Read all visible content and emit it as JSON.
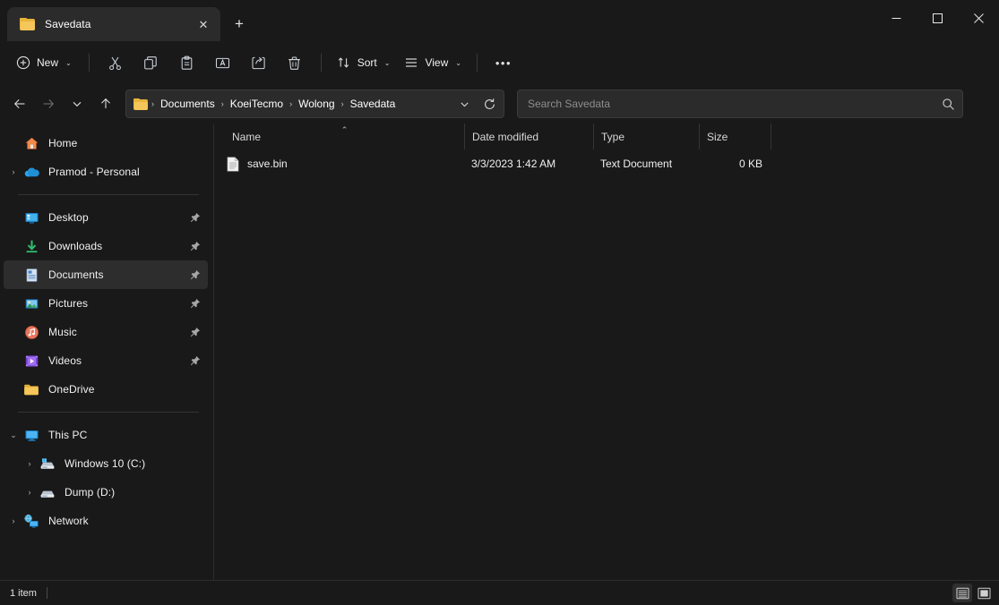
{
  "window": {
    "tab_title": "Savedata",
    "tab_close_label": "✕",
    "new_tab_label": "+",
    "minimize_label": "–",
    "maximize_label": "□",
    "close_label": "✕"
  },
  "toolbar": {
    "new_label": "New",
    "new_chevron": "⌄",
    "cut_label": "Cut",
    "copy_label": "Copy",
    "paste_label": "Paste",
    "rename_label": "Rename",
    "share_label": "Share",
    "delete_label": "Delete",
    "sort_label": "Sort",
    "sort_chevron": "⌄",
    "view_label": "View",
    "view_chevron": "⌄",
    "more_label": "•••"
  },
  "address": {
    "back_label": "←",
    "forward_label": "→",
    "recent_label": "⌄",
    "up_label": "↑",
    "crumbs": [
      "Documents",
      "KoeiTecmo",
      "Wolong",
      "Savedata"
    ],
    "separator": "›",
    "dropdown_label": "⌄",
    "refresh_label": "↻"
  },
  "search": {
    "placeholder": "Search Savedata",
    "value": ""
  },
  "sidebar": {
    "items": [
      {
        "label": "Home",
        "icon": "home-icon",
        "expander": "",
        "pinned": false,
        "selected": false,
        "indent": 0
      },
      {
        "label": "Pramod - Personal",
        "icon": "onedrive-cloud-icon",
        "expander": "›",
        "pinned": false,
        "selected": false,
        "indent": 0
      },
      {
        "label": "Desktop",
        "icon": "desktop-icon",
        "expander": "",
        "pinned": true,
        "selected": false,
        "indent": 0
      },
      {
        "label": "Downloads",
        "icon": "downloads-icon",
        "expander": "",
        "pinned": true,
        "selected": false,
        "indent": 0
      },
      {
        "label": "Documents",
        "icon": "documents-icon",
        "expander": "",
        "pinned": true,
        "selected": true,
        "indent": 0
      },
      {
        "label": "Pictures",
        "icon": "pictures-icon",
        "expander": "",
        "pinned": true,
        "selected": false,
        "indent": 0
      },
      {
        "label": "Music",
        "icon": "music-icon",
        "expander": "",
        "pinned": true,
        "selected": false,
        "indent": 0
      },
      {
        "label": "Videos",
        "icon": "videos-icon",
        "expander": "",
        "pinned": true,
        "selected": false,
        "indent": 0
      },
      {
        "label": "OneDrive",
        "icon": "folder-icon",
        "expander": "",
        "pinned": false,
        "selected": false,
        "indent": 0
      },
      {
        "label": "This PC",
        "icon": "thispc-icon",
        "expander": "⌄",
        "pinned": false,
        "selected": false,
        "indent": 0
      },
      {
        "label": "Windows 10 (C:)",
        "icon": "windows-drive-icon",
        "expander": "›",
        "pinned": false,
        "selected": false,
        "indent": 1
      },
      {
        "label": "Dump (D:)",
        "icon": "drive-icon",
        "expander": "›",
        "pinned": false,
        "selected": false,
        "indent": 1
      },
      {
        "label": "Network",
        "icon": "network-icon",
        "expander": "›",
        "pinned": false,
        "selected": false,
        "indent": 0
      }
    ]
  },
  "filelist": {
    "columns": [
      {
        "label": "Name",
        "sorted": true,
        "sort_caret": "⌃"
      },
      {
        "label": "Date modified",
        "sorted": false,
        "sort_caret": ""
      },
      {
        "label": "Type",
        "sorted": false,
        "sort_caret": ""
      },
      {
        "label": "Size",
        "sorted": false,
        "sort_caret": ""
      }
    ],
    "rows": [
      {
        "name": "save.bin",
        "date_modified": "3/3/2023 1:42 AM",
        "type": "Text Document",
        "size": "0 KB",
        "icon": "text-document-icon"
      }
    ]
  },
  "statusbar": {
    "item_count": "1 item",
    "details_view_label": "Details view",
    "large_icons_view_label": "Large icons view"
  },
  "colors": {
    "window_bg": "#191919",
    "tab_bg": "#2b2b2b",
    "selection_bg": "#2d2d2d",
    "folder_yellow": "#f5c659",
    "accent_blue": "#4cb5f5",
    "text_primary": "#ffffff",
    "text_secondary": "#8e8e8e"
  }
}
